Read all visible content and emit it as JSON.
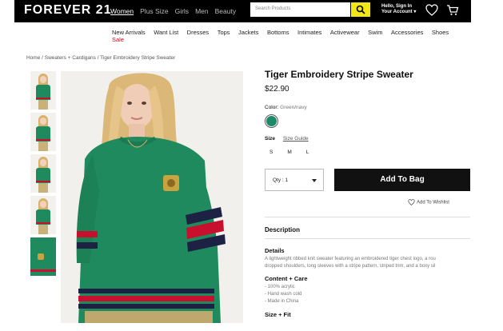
{
  "header": {
    "logo": "FOREVER 21",
    "nav": [
      "Women",
      "Plus Size",
      "Girls",
      "Men",
      "Beauty"
    ],
    "active_nav": "Women",
    "search_placeholder": "Search Products",
    "account_line1": "Hello, Sign In",
    "account_line2": "Your Account ▾"
  },
  "category_nav": {
    "items": [
      "New Arrivals",
      "Want List",
      "Dresses",
      "Tops",
      "Jackets",
      "Bottoms",
      "Intimates",
      "Activewear",
      "Swim",
      "Accessories",
      "Shoes"
    ],
    "sale": "Sale"
  },
  "breadcrumb": "Home / Sweaters + Cardigans / Tiger Embroidery Stripe Sweater",
  "product": {
    "title": "Tiger Embroidery Stripe Sweater",
    "price": "$22.90",
    "color_label": "Color",
    "color_value": "Green/navy",
    "swatch_color": "#1c8a68",
    "size_label": "Size",
    "size_guide": "Size Guide",
    "sizes": [
      "S",
      "M",
      "L"
    ],
    "qty": "Qty : 1",
    "add_to_bag": "Add To Bag",
    "wishlist": "Add To Wishlist"
  },
  "description": {
    "heading": "Description",
    "details_heading": "Details",
    "details_line1": "A lightweight ribbed knit sweater featuring an embroidered tiger chest logo, a rou",
    "details_line2": "dropped shoulders, long sleeves with a stripe pattern, striped trim, and a boxy sil",
    "care_heading": "Content + Care",
    "care_items": [
      "- 100% acrylic",
      "- Hand wash cold",
      "- Made in China"
    ],
    "fit_heading": "Size + Fit"
  },
  "colors": {
    "topbar": "#000000",
    "search_button": "#f2e616",
    "sale": "#d0021b",
    "sweater_green": "#1f8a5e",
    "stripe_red": "#c8102e",
    "stripe_navy": "#1d2144"
  }
}
